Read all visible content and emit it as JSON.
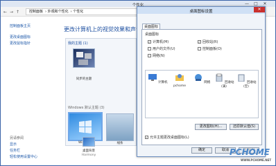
{
  "window": {
    "title": "个性化",
    "controls": [
      "—",
      "□",
      "✕"
    ]
  },
  "address": {
    "crumbs": [
      "控制面板",
      "外观和个性化",
      "个性化"
    ]
  },
  "sidebar": {
    "items": [
      "控制面板主页",
      "更改桌面图标",
      "更改鼠标指针"
    ],
    "see_also_header": "另请参阅",
    "see_also": [
      "显示",
      "任务栏",
      "轻松使用设置中心"
    ]
  },
  "main": {
    "heading": "更改计算机上的视觉效果和声音",
    "my_themes": "我的主题 (1)",
    "synced_theme": "同步的主题",
    "default_themes": "Windows 默认主题 (3)",
    "themes": [
      "Windows",
      "线条"
    ],
    "bottom_items": [
      {
        "label": "桌面背景",
        "sub": "Harmony"
      }
    ]
  },
  "dialog": {
    "title": "桌面图标设置",
    "tab": "桌面图标",
    "group": "桌面图标",
    "checkboxes": [
      {
        "label": "计算机(M)",
        "checked": true
      },
      {
        "label": "回收站(R)",
        "checked": true
      },
      {
        "label": "用户的文件(U)",
        "checked": false
      },
      {
        "label": "控制面板(O)",
        "checked": false
      },
      {
        "label": "网络(N)",
        "checked": false
      }
    ],
    "icons": [
      "计算机",
      "pchome",
      "网络",
      "回收站(满)",
      "回收站(空)"
    ],
    "change_icon": "更改图标(H)...",
    "restore_default": "还原默认值(S)",
    "allow_themes": "允许主题更改桌面图标(L)",
    "ok": "确定",
    "cancel": "取消",
    "apply": "应用(A)"
  },
  "watermark": {
    "text": "PCHOME",
    "url": "WWW.PCHOME.NET"
  }
}
